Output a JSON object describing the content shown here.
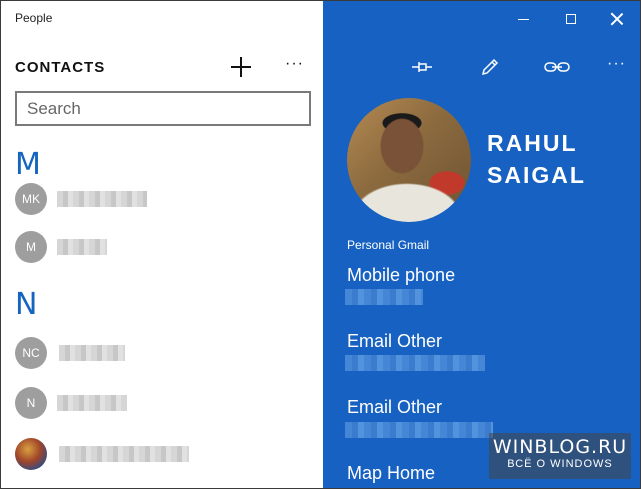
{
  "app": {
    "title": "People"
  },
  "contacts_panel": {
    "heading": "CONTACTS",
    "more_label": "···",
    "search_placeholder": "Search",
    "groups": [
      {
        "letter": "M",
        "contacts": [
          {
            "initials": "MK"
          },
          {
            "initials": "M"
          }
        ]
      },
      {
        "letter": "N",
        "contacts": [
          {
            "initials": "NC"
          },
          {
            "initials": "N"
          },
          {
            "initials": ""
          }
        ]
      }
    ]
  },
  "detail_panel": {
    "more_label": "···",
    "name_line1": "RAHUL",
    "name_line2": "SAIGAL",
    "account": "Personal Gmail",
    "fields": [
      {
        "label": "Mobile phone"
      },
      {
        "label": "Email Other"
      },
      {
        "label": "Email Other"
      },
      {
        "label": "Map Home"
      }
    ]
  },
  "watermark": {
    "title": "WINBLOG.RU",
    "subtitle": "ВСЁ О WINDOWS"
  },
  "colors": {
    "accent": "#1661c2",
    "letter": "#1565c0",
    "avatar": "#9e9e9e"
  }
}
